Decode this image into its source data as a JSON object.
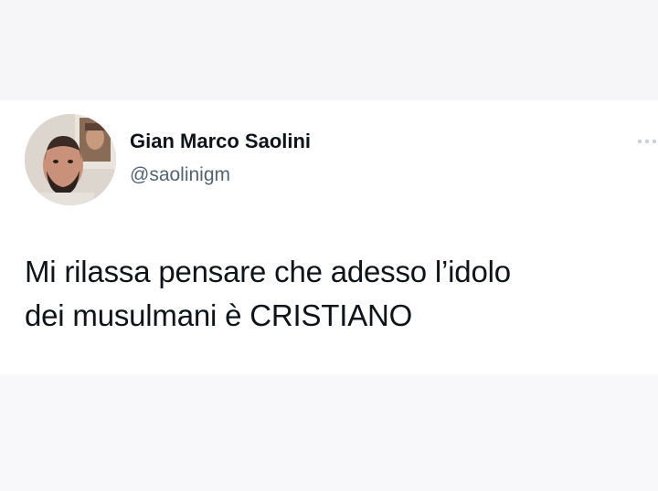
{
  "tweet": {
    "author": {
      "display_name": "Gian Marco Saolini",
      "handle": "@saolinigm",
      "avatar_icon": "profile-photo"
    },
    "text_lines": [
      "Mi rilassa pensare che adesso l’idolo",
      "dei musulmani è CRISTIANO"
    ],
    "more_icon": "more-options-icon"
  },
  "colors": {
    "background": "#f6f6f8",
    "card": "#ffffff",
    "name_text": "#0f1419",
    "handle_text": "#536471"
  }
}
